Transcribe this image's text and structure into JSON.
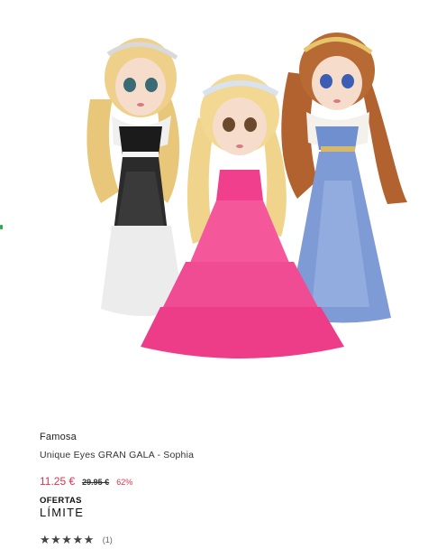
{
  "product": {
    "brand": "Famosa",
    "name": "Unique Eyes GRAN GALA - Sophia",
    "price_current": "11.25 €",
    "price_old": "29.95 €",
    "discount": "62%",
    "offer_line1": "OFERTAS",
    "offer_line2": "LÍMITE",
    "stars": "★★★★★",
    "review_count": "(1)",
    "rating": 5
  },
  "colors": {
    "accent_price": "#e2314a",
    "side_marker": "#2fa84f"
  },
  "icons": {
    "rating": "star-icon"
  }
}
